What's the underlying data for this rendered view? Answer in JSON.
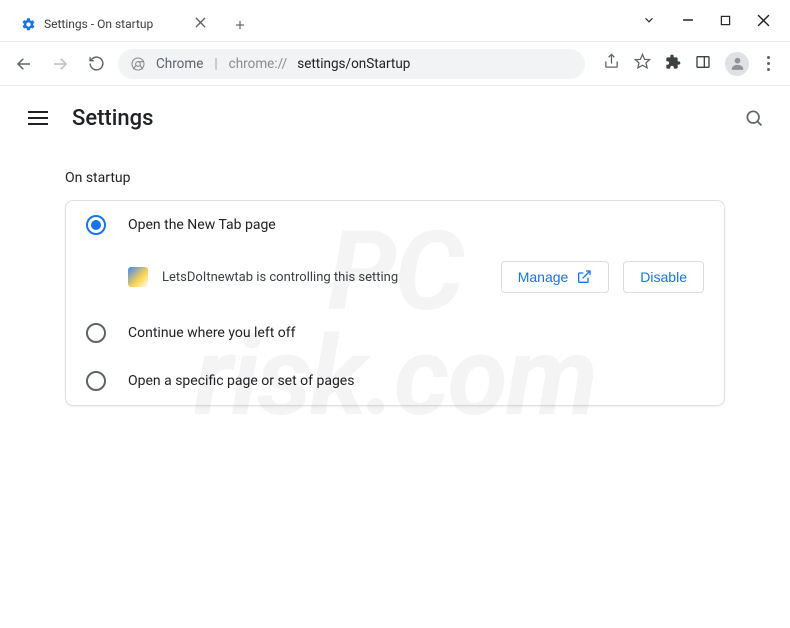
{
  "window": {
    "tab_title": "Settings - On startup"
  },
  "omnibox": {
    "label": "Chrome",
    "url_prefix": "chrome://",
    "url_path": "settings/onStartup"
  },
  "header": {
    "title": "Settings"
  },
  "section": {
    "label": "On startup"
  },
  "options": [
    {
      "label": "Open the New Tab page",
      "selected": true
    },
    {
      "label": "Continue where you left off",
      "selected": false
    },
    {
      "label": "Open a specific page or set of pages",
      "selected": false
    }
  ],
  "extension_notice": {
    "name": "LetsDoItnewtab",
    "message": "LetsDoItnewtab is controlling this setting",
    "manage_label": "Manage",
    "disable_label": "Disable"
  },
  "watermark": {
    "line1": "PC",
    "line2": "risk.com"
  }
}
